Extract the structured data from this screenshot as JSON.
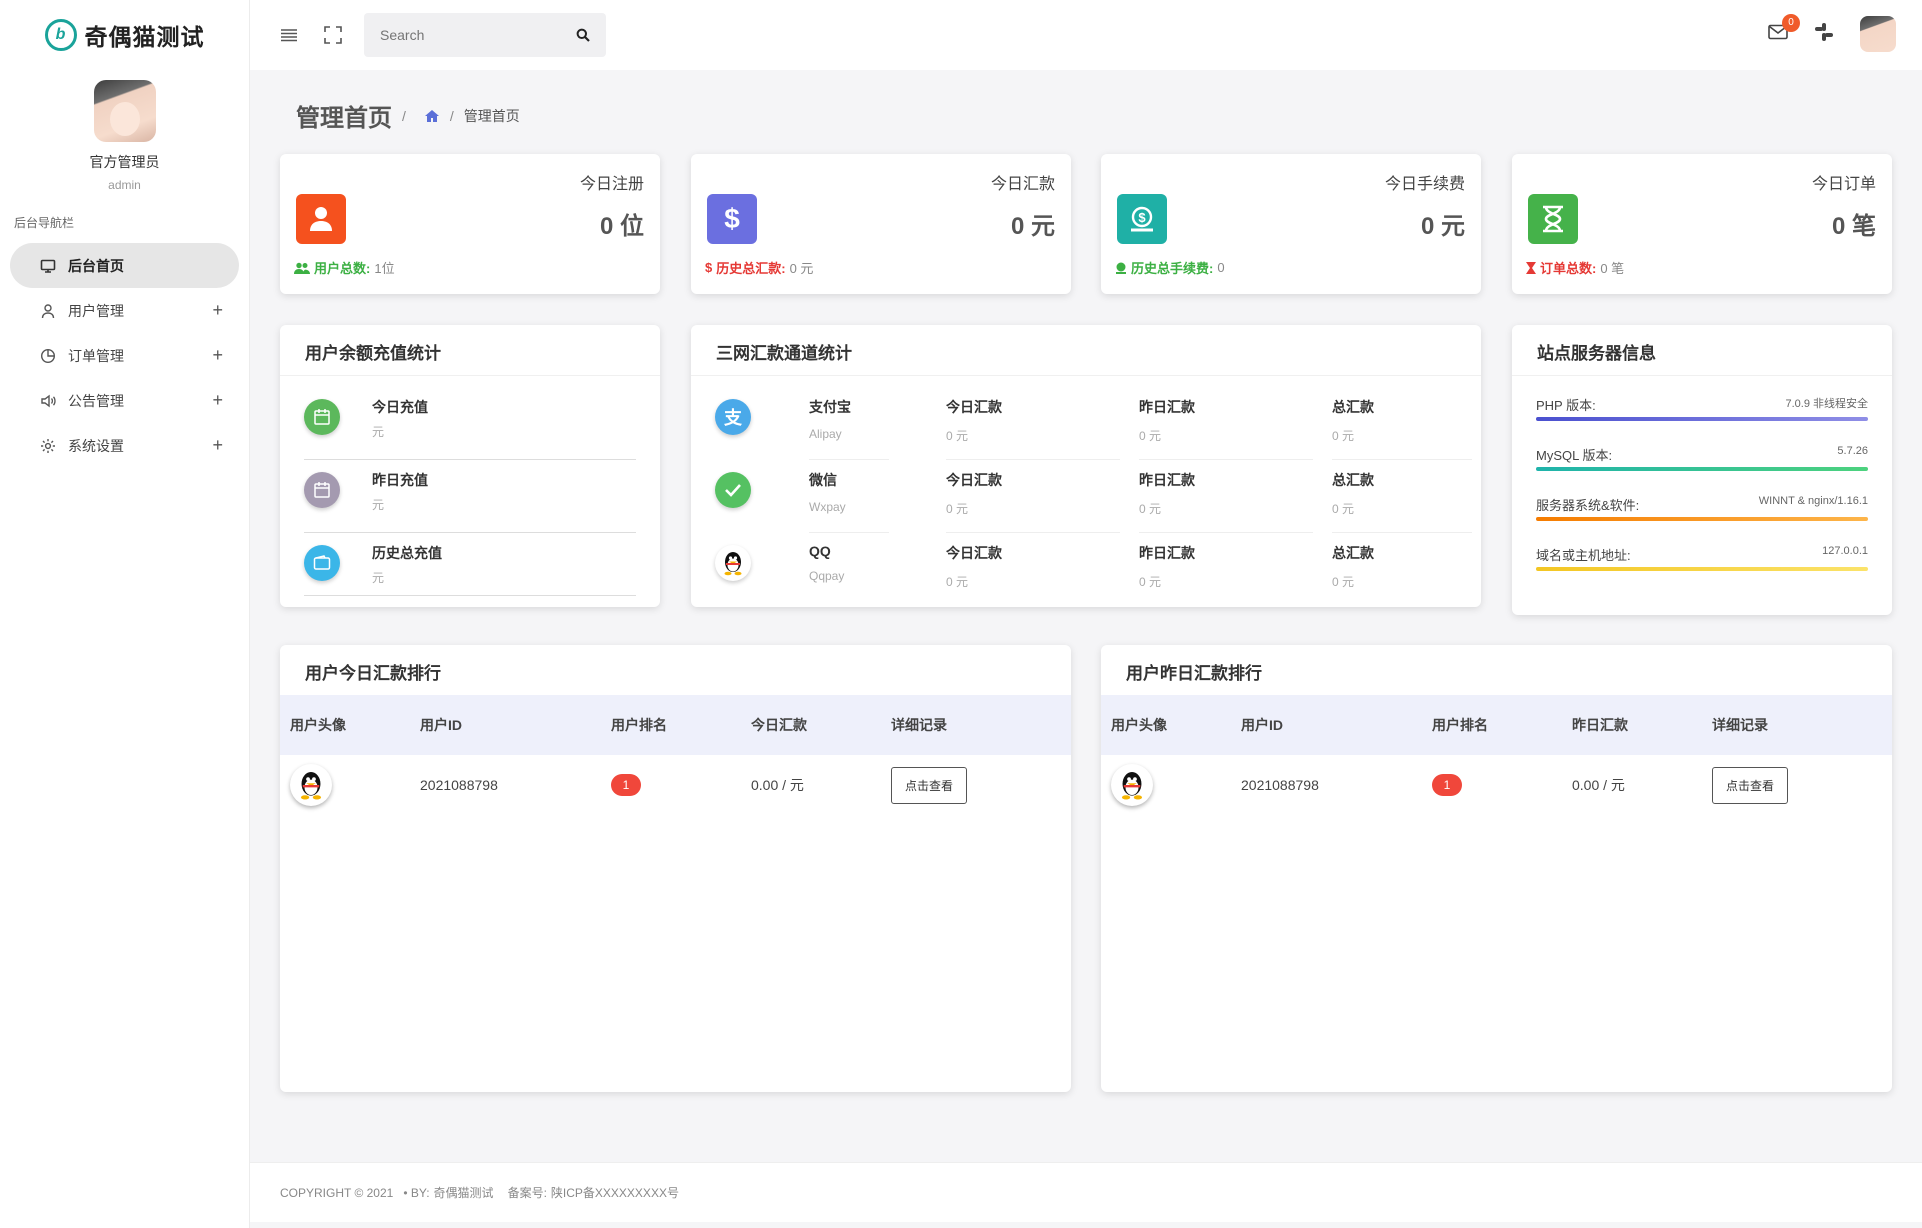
{
  "brand": {
    "title": "奇偶猫测试",
    "logo_letter": "b"
  },
  "profile": {
    "name": "官方管理员",
    "role": "admin"
  },
  "nav": {
    "title": "后台导航栏",
    "items": [
      {
        "label": "后台首页",
        "icon": "monitor-icon",
        "active": true
      },
      {
        "label": "用户管理",
        "icon": "user-icon"
      },
      {
        "label": "订单管理",
        "icon": "pie-chart-icon"
      },
      {
        "label": "公告管理",
        "icon": "speaker-icon"
      },
      {
        "label": "系统设置",
        "icon": "gear-icon"
      }
    ],
    "expand": "+"
  },
  "header": {
    "search_placeholder": "Search",
    "mail_count": "0"
  },
  "breadcrumb": {
    "title": "管理首页",
    "sep": "/",
    "current": "管理首页"
  },
  "stats": [
    {
      "label": "今日注册",
      "value": "0 位",
      "foot_key": "用户总数:",
      "foot_val": "1位",
      "color": "#f5511e",
      "foot_color": "#3cb043"
    },
    {
      "label": "今日汇款",
      "value": "0 元",
      "foot_key": "历史总汇款:",
      "foot_val": "0 元",
      "color": "#6b6fe0",
      "foot_color": "#e53935"
    },
    {
      "label": "今日手续费",
      "value": "0 元",
      "foot_key": "历史总手续费:",
      "foot_val": "0",
      "color": "#1fb0a6",
      "foot_color": "#3cb043"
    },
    {
      "label": "今日订单",
      "value": "0 笔",
      "foot_key": "订单总数:",
      "foot_val": "0 笔",
      "color": "#45b24a",
      "foot_color": "#e53935"
    }
  ],
  "recharge": {
    "title": "用户余额充值统计",
    "rows": [
      {
        "label": "今日充值",
        "unit": "元",
        "color": "#5cb85c"
      },
      {
        "label": "昨日充值",
        "unit": "元",
        "color": "#a49ab0"
      },
      {
        "label": "历史总充值",
        "unit": "元",
        "color": "#3bb6e8"
      }
    ]
  },
  "channels": {
    "title": "三网汇款通道统计",
    "rows": [
      {
        "name": "支付宝",
        "en": "Alipay",
        "today": "今日汇款",
        "today_v": "0 元",
        "yest": "昨日汇款",
        "yest_v": "0 元",
        "total": "总汇款",
        "total_v": "0 元",
        "color": "#4aa9e9"
      },
      {
        "name": "微信",
        "en": "Wxpay",
        "today": "今日汇款",
        "today_v": "0 元",
        "yest": "昨日汇款",
        "yest_v": "0 元",
        "total": "总汇款",
        "total_v": "0 元",
        "color": "#55c162"
      },
      {
        "name": "QQ",
        "en": "Qqpay",
        "today": "今日汇款",
        "today_v": "0 元",
        "yest": "昨日汇款",
        "yest_v": "0 元",
        "total": "总汇款",
        "total_v": "0 元",
        "color": "#ffffff"
      }
    ]
  },
  "server": {
    "title": "站点服务器信息",
    "rows": [
      {
        "key": "PHP 版本:",
        "val": "7.0.9 非线程安全",
        "color": "#5b5fd8"
      },
      {
        "key": "MySQL 版本:",
        "val": "5.7.26",
        "color": "#26c2a5"
      },
      {
        "key": "服务器系统&软件:",
        "val": "WINNT & nginx/1.16.1",
        "color": "#fb8c1c"
      },
      {
        "key": "域名或主机地址:",
        "val": "127.0.0.1",
        "color": "#f5d32c"
      }
    ]
  },
  "rank_today": {
    "title": "用户今日汇款排行",
    "headers": [
      "用户头像",
      "用户ID",
      "用户排名",
      "今日汇款",
      "详细记录"
    ],
    "rows": [
      {
        "uid": "2021088798",
        "rank": "1",
        "amount": "0.00 / 元",
        "btn": "点击查看"
      }
    ]
  },
  "rank_yesterday": {
    "title": "用户昨日汇款排行",
    "headers": [
      "用户头像",
      "用户ID",
      "用户排名",
      "昨日汇款",
      "详细记录"
    ],
    "rows": [
      {
        "uid": "2021088798",
        "rank": "1",
        "amount": "0.00 / 元",
        "btn": "点击查看"
      }
    ]
  },
  "footer": {
    "copyright": "COPYRIGHT © 2021",
    "by": "• BY:",
    "author": "奇偶猫测试",
    "icp_label": "备案号:",
    "icp": "陕ICP备XXXXXXXXX号"
  }
}
